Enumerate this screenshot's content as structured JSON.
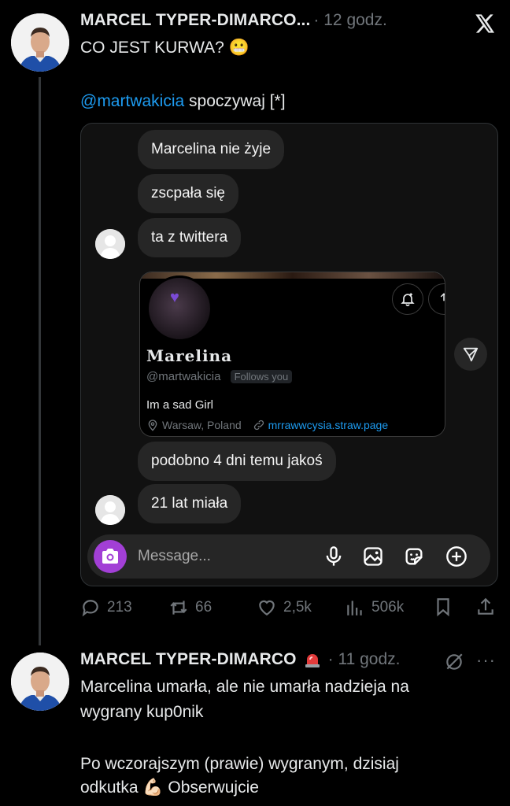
{
  "post1": {
    "author": "MARCEL TYPER-DIMARCO...",
    "time": "· 12 godz.",
    "text_line1": "CO JEST KURWA? 😬",
    "mention": "@martwakicia",
    "text_after_mention": " spoczywaj [*]",
    "dm": {
      "bubbles": [
        "Marcelina nie żyje",
        "zscpała się",
        "ta z twittera",
        "podobno 4 dni temu jakoś",
        "21 lat miała"
      ],
      "profile_card": {
        "name": "Marelina",
        "handle": "@martwakicia",
        "follows_you": "Follows you",
        "bio": "Im a sad Girl",
        "location": "Warsaw, Poland",
        "link": "mrrawwcysia.straw.page"
      },
      "composer_placeholder": "Message..."
    },
    "actions": {
      "replies": "213",
      "reposts": "66",
      "likes": "2,5k",
      "views": "506k"
    }
  },
  "post2": {
    "author": "MARCEL TYPER-DIMARCO",
    "time": "· 11 godz.",
    "more": "···",
    "line1": "Marcelina umarła, ale nie umarła nadzieja na",
    "line2": "wygrany kup0nik",
    "line3": "Po wczorajszym (prawie) wygranym, dzisiaj",
    "line4": "odkutka 💪🏻 Obserwujcie"
  },
  "colors": {
    "accent": "#1d9bf0",
    "muted": "#71767b",
    "camera": "#a23fd6"
  }
}
